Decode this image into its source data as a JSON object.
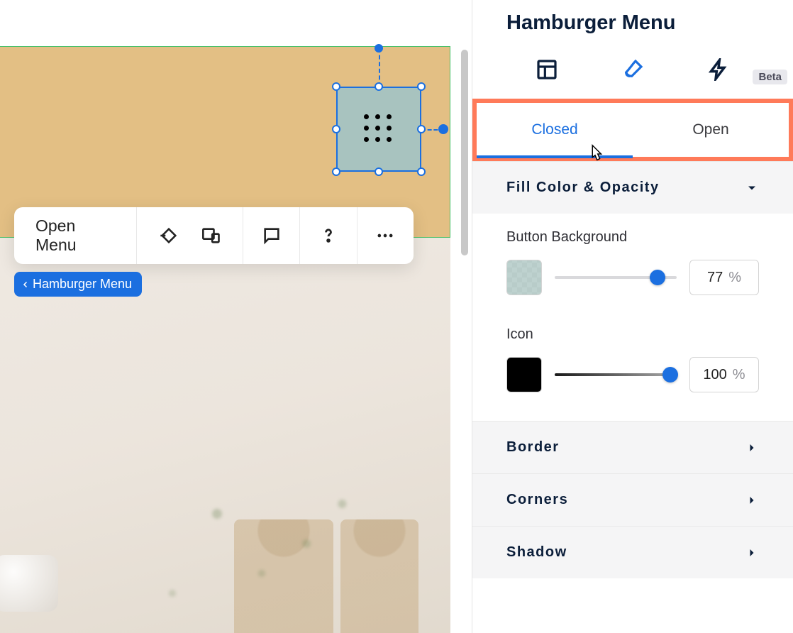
{
  "panel": {
    "title": "Hamburger Menu",
    "beta_label": "Beta",
    "state_tabs": {
      "closed": "Closed",
      "open": "Open",
      "active": "closed"
    }
  },
  "design": {
    "fill_section": "Fill Color & Opacity",
    "button_bg_label": "Button Background",
    "button_bg_opacity": "77",
    "button_bg_unit": "%",
    "icon_label": "Icon",
    "icon_opacity": "100",
    "icon_unit": "%",
    "border_section": "Border",
    "corners_section": "Corners",
    "shadow_section": "Shadow",
    "colors": {
      "button_bg": "#a8c3bf",
      "icon": "#000000"
    }
  },
  "canvas": {
    "toolbar": {
      "open_menu": "Open Menu"
    },
    "breadcrumb": "Hamburger Menu"
  }
}
